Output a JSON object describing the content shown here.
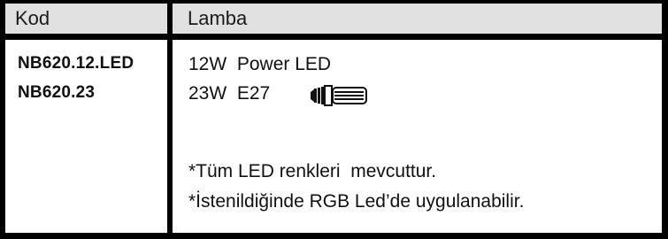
{
  "table": {
    "headers": {
      "code": "Kod",
      "lamp": "Lamba"
    },
    "codes": [
      "NB620.12.LED",
      "NB620.23"
    ],
    "lamps": [
      "12W  Power LED",
      "23W  E27"
    ],
    "notes": [
      "*Tüm LED renkleri  mevcuttur.",
      "*İstenildiğinde RGB Led’de uygulanabilir."
    ],
    "lamp_icon": "e27-bulb-icon"
  }
}
